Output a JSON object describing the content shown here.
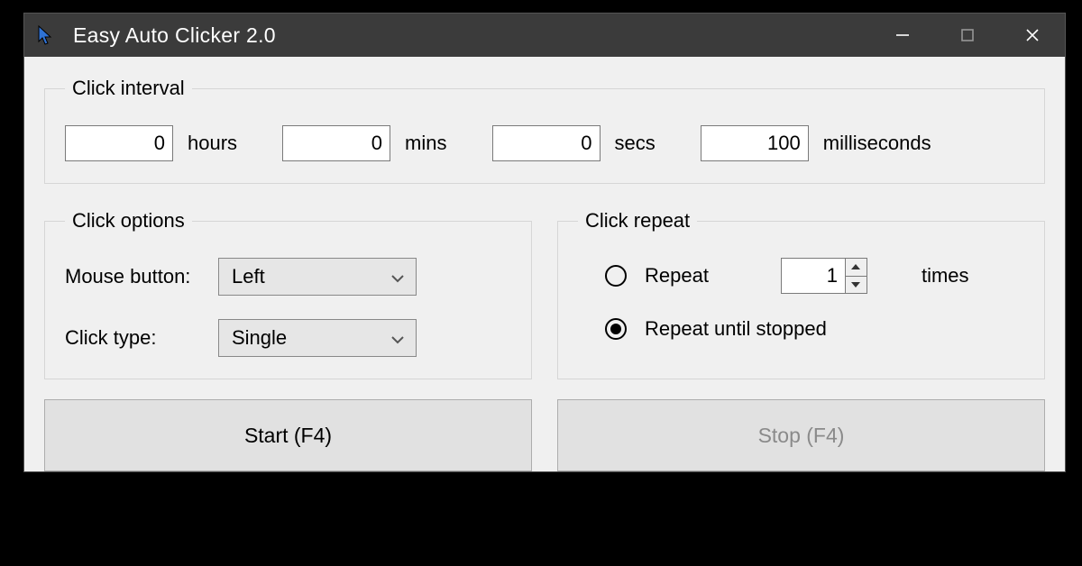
{
  "window": {
    "title": "Easy Auto Clicker 2.0"
  },
  "interval": {
    "legend": "Click interval",
    "hours": {
      "value": "0",
      "unit": "hours"
    },
    "mins": {
      "value": "0",
      "unit": "mins"
    },
    "secs": {
      "value": "0",
      "unit": "secs"
    },
    "ms": {
      "value": "100",
      "unit": "milliseconds"
    }
  },
  "options": {
    "legend": "Click options",
    "mouse_button_label": "Mouse button:",
    "mouse_button_value": "Left",
    "click_type_label": "Click type:",
    "click_type_value": "Single"
  },
  "repeat": {
    "legend": "Click repeat",
    "repeat_label": "Repeat",
    "repeat_times_value": "1",
    "repeat_times_unit": "times",
    "repeat_until_label": "Repeat until stopped",
    "selected": "until_stopped"
  },
  "buttons": {
    "start": "Start (F4)",
    "stop": "Stop (F4)"
  }
}
